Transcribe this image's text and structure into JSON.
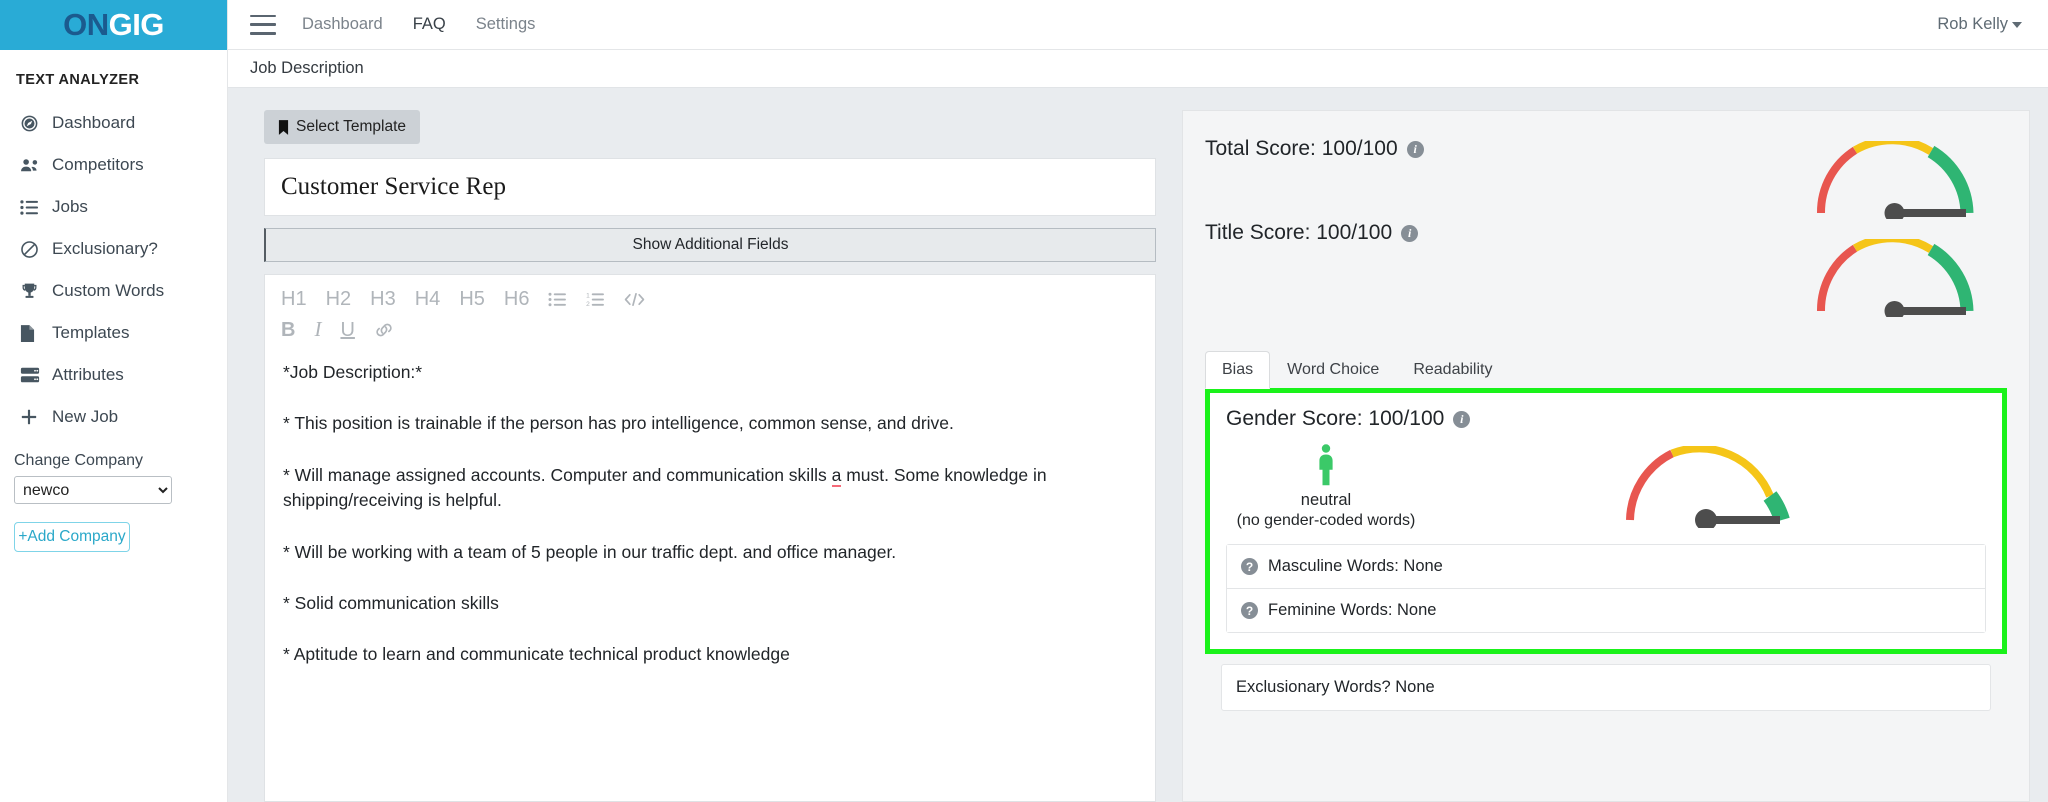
{
  "brand": {
    "logo_on": "ON",
    "logo_gig": "GIG",
    "bar_color": "#29ABD6"
  },
  "sidebar": {
    "title": "TEXT ANALYZER",
    "items": [
      {
        "label": "Dashboard",
        "icon": "speedometer-icon"
      },
      {
        "label": "Competitors",
        "icon": "people-icon"
      },
      {
        "label": "Jobs",
        "icon": "list-icon"
      },
      {
        "label": "Exclusionary?",
        "icon": "ban-icon"
      },
      {
        "label": "Custom Words",
        "icon": "trophy-icon"
      },
      {
        "label": "Templates",
        "icon": "document-icon"
      },
      {
        "label": "Attributes",
        "icon": "server-icon"
      },
      {
        "label": "New Job",
        "icon": "plus-icon"
      }
    ],
    "change_company_label": "Change Company",
    "company_selected": "newco",
    "company_options": [
      "newco"
    ],
    "add_company_label": "+Add Company"
  },
  "topbar": {
    "nav": [
      {
        "label": "Dashboard",
        "active": false
      },
      {
        "label": "FAQ",
        "active": true
      },
      {
        "label": "Settings",
        "active": false
      }
    ],
    "user": "Rob Kelly"
  },
  "breadcrumb": "Job Description",
  "editor": {
    "select_template_label": "Select Template",
    "job_title": "Customer Service Rep",
    "show_additional_fields_label": "Show Additional Fields",
    "toolbar_row1": [
      "H1",
      "H2",
      "H3",
      "H4",
      "H5",
      "H6"
    ],
    "toolbar_icons_row1": [
      "bullet-list-icon",
      "numbered-list-icon",
      "code-icon"
    ],
    "toolbar_row2": [
      "B",
      "I",
      "U"
    ],
    "toolbar_icons_row2": [
      "link-icon"
    ],
    "paragraphs": [
      {
        "text": "*Job Description:*"
      },
      {
        "text": "* This position is trainable if the person has pro intelligence, common sense, and drive."
      },
      {
        "pre": "* Will manage assigned accounts. Computer and communication skills ",
        "flagged": "a",
        "post": " must. Some knowledge in shipping/receiving is helpful."
      },
      {
        "text": " * Will be working with a team of 5 people in our traffic dept. and office manager."
      },
      {
        "text": "* Solid communication skills"
      },
      {
        "text": "* Aptitude to learn and communicate technical product knowledge"
      }
    ]
  },
  "scores": {
    "total_label": "Total Score: 100/100",
    "title_label": "Title Score: 100/100",
    "tabs": [
      {
        "label": "Bias",
        "active": true
      },
      {
        "label": "Word Choice",
        "active": false
      },
      {
        "label": "Readability",
        "active": false
      }
    ],
    "gender": {
      "title": "Gender Score: 100/100",
      "state": "neutral",
      "state_sub": "(no gender-coded words)",
      "person_icon_color": "#3BC968",
      "highlight_color": "#1AF21A",
      "words": [
        {
          "label": "Masculine Words: None",
          "icon": "question-icon"
        },
        {
          "label": "Feminine Words: None",
          "icon": "question-icon"
        }
      ]
    },
    "exclusionary_label": "Exclusionary Words? None",
    "gauge_colors": {
      "red": "#E8564F",
      "yellow": "#F5C518",
      "green": "#2FB573",
      "needle": "#4D4D4D"
    }
  }
}
